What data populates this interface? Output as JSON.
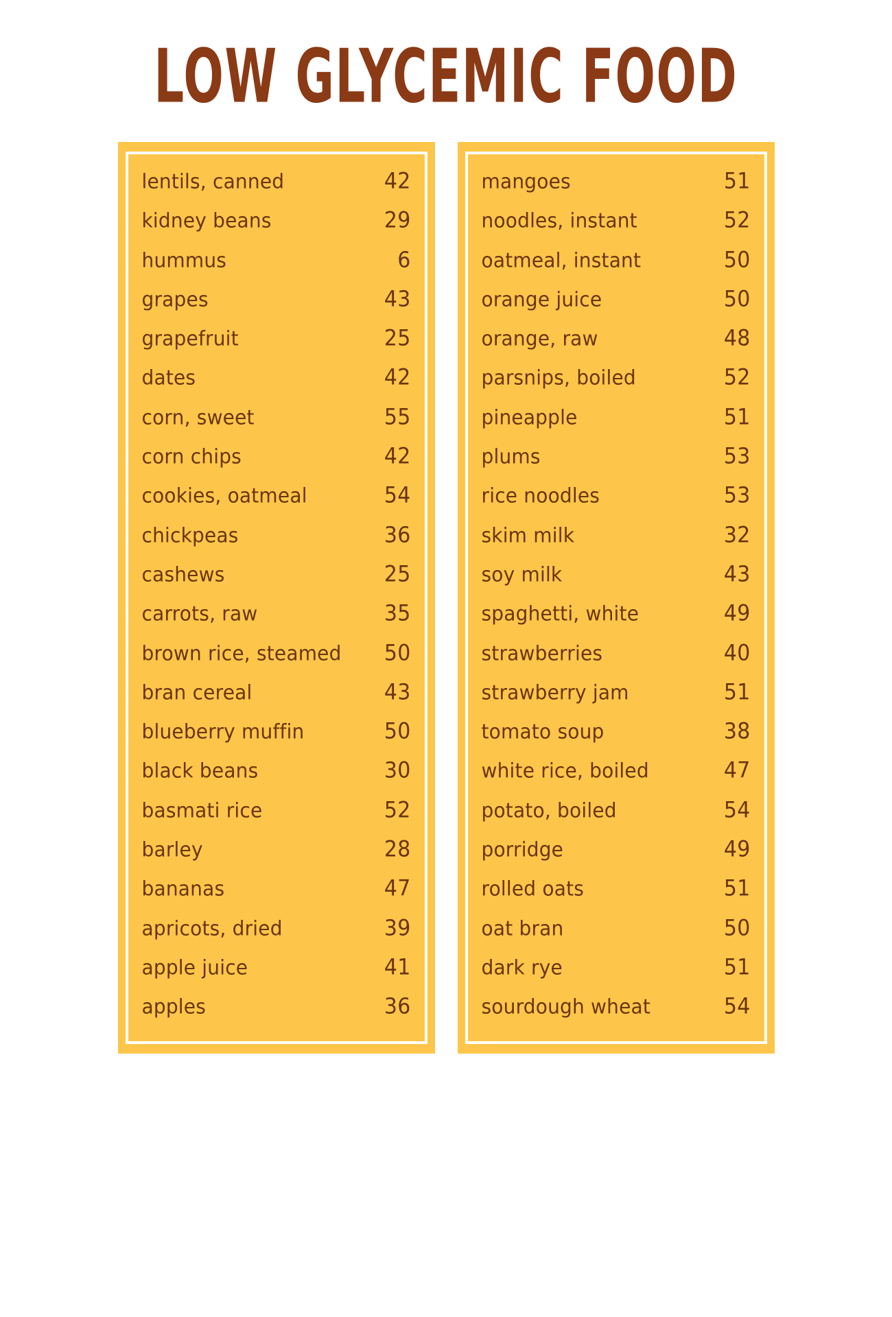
{
  "page": {
    "title": "LOW GLYCEMIC FOOD",
    "background_color": "#FFFFFF",
    "panel_color": "#FDC64A",
    "panel_border_color": "#FFFFFF",
    "title_color": "#8B3A16",
    "text_color": "#6B3410"
  },
  "columns": [
    {
      "name": "left-column",
      "rows": [
        {
          "food": "lentils, canned",
          "value": "42"
        },
        {
          "food": "kidney beans",
          "value": "29"
        },
        {
          "food": "hummus",
          "value": "6"
        },
        {
          "food": "grapes",
          "value": "43"
        },
        {
          "food": "grapefruit",
          "value": "25"
        },
        {
          "food": "dates",
          "value": "42"
        },
        {
          "food": "corn, sweet",
          "value": "55"
        },
        {
          "food": "corn chips",
          "value": "42"
        },
        {
          "food": "cookies, oatmeal",
          "value": "54"
        },
        {
          "food": "chickpeas",
          "value": "36"
        },
        {
          "food": "cashews",
          "value": "25"
        },
        {
          "food": "carrots, raw",
          "value": "35"
        },
        {
          "food": "brown rice, steamed",
          "value": "50"
        },
        {
          "food": "bran cereal",
          "value": "43"
        },
        {
          "food": "blueberry muffin",
          "value": "50"
        },
        {
          "food": "black beans",
          "value": "30"
        },
        {
          "food": "basmati rice",
          "value": "52"
        },
        {
          "food": "barley",
          "value": "28"
        },
        {
          "food": "bananas",
          "value": "47"
        },
        {
          "food": "apricots, dried",
          "value": "39"
        },
        {
          "food": "apple juice",
          "value": "41"
        },
        {
          "food": "apples",
          "value": "36"
        }
      ]
    },
    {
      "name": "right-column",
      "rows": [
        {
          "food": "mangoes",
          "value": "51"
        },
        {
          "food": "noodles, instant",
          "value": "52"
        },
        {
          "food": "oatmeal, instant",
          "value": "50"
        },
        {
          "food": "orange juice",
          "value": "50"
        },
        {
          "food": "orange, raw",
          "value": "48"
        },
        {
          "food": "parsnips, boiled",
          "value": "52"
        },
        {
          "food": "pineapple",
          "value": "51"
        },
        {
          "food": "plums",
          "value": "53"
        },
        {
          "food": "rice noodles",
          "value": "53"
        },
        {
          "food": "skim milk",
          "value": "32"
        },
        {
          "food": "soy milk",
          "value": "43"
        },
        {
          "food": "spaghetti, white",
          "value": "49"
        },
        {
          "food": "strawberries",
          "value": "40"
        },
        {
          "food": "strawberry jam",
          "value": "51"
        },
        {
          "food": "tomato soup",
          "value": "38"
        },
        {
          "food": "white rice, boiled",
          "value": "47"
        },
        {
          "food": "potato, boiled",
          "value": "54"
        },
        {
          "food": "porridge",
          "value": "49"
        },
        {
          "food": "rolled oats",
          "value": "51"
        },
        {
          "food": "oat bran",
          "value": "50"
        },
        {
          "food": "dark rye",
          "value": "51"
        },
        {
          "food": "sourdough  wheat",
          "value": "54"
        }
      ]
    }
  ]
}
